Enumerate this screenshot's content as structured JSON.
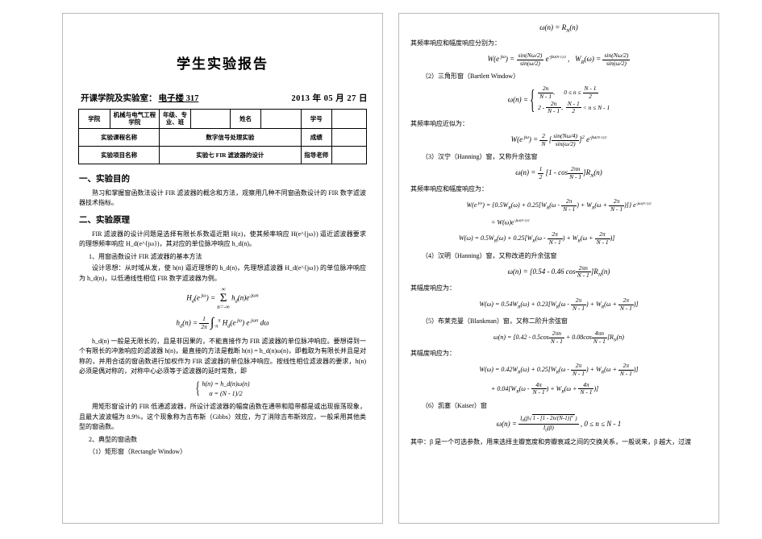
{
  "document": {
    "title": "学生实验报告",
    "meta": {
      "label": "开课学院及实验室：",
      "value": "电子楼 317",
      "date": "2013 年 05 月 27 日"
    },
    "info_table": {
      "row1": [
        "学院",
        "机械与电气工程学院",
        "年级、专业、班",
        "姓名",
        "学号"
      ],
      "row2_label": "实验课程名称",
      "row2_value": "数字信号处理实验",
      "row2_grade_label": "成绩",
      "row3_label": "实验项目名称",
      "row3_value": "实验七   FIR 滤波器的设计",
      "row3_teacher_label": "指导老师"
    },
    "sections": [
      {
        "heading": "一、实验目的",
        "paragraphs": [
          "熟习和掌握窗函数法设计 FIR 滤波器的概念和方法，观察用几种不同窗函数设计的 FIR 数字滤波器技术指标。"
        ]
      },
      {
        "heading": "二、实验原理",
        "paragraphs": [
          "FIR 滤波器的设计问题是选择有限长系数逼近期 H(z)，使其频率响应 H(e^{jω}) 逼近滤波器要求的理想频率响应 H_d(e^{jω})，其对应的单位脉冲响应 h_d(n)。"
        ],
        "sub1": "1、用窗函数设计 FIR 滤波器的基本方法",
        "sub1_paras": [
          "设计思想：从时域从发，使 h(n) 逼近理想的 h_d(n)，先理想滤波器 H_d(e^{jω}) 的单位脉冲响应为 h_d(n)，以低通线性相位 FIR 数字滤波器为例。"
        ],
        "eq1": "H_d(e^{jω}) = Σ h_d(n)e^{-jωn}",
        "eq2": "h_d(n) = (1/2π) ∫ H_d(e^{jω}) e^{jωn} dω",
        "sub1_paras2": [
          "h_d(n) 一般是无限长的，且是非因果的，不能直接作为 FIR 滤波器的单位脉冲响应。要想得到一个有限长的冲激响应的滤波器 h(n)，最直接的方法是截断 h(n) = h_d(n)ω(n)，即截取为有限长并且是对称的，并用合适的窗函数进行加权作为 FIR 滤波器的单位脉冲响应。按线性相位滤波器的要求，h(n) 必须是偶对称的，对称中心必须等于滤波器的延时常数，即",
          "用矩形窗设计的 FIR 低通滤波器，所设计滤波器的幅度函数在通带和阻带都是或出现振荡现象，且最大波波幅为 8.9%，这个现象称为吉布斯（Gibbs）效应，为了消除吉布斯效应，一般采用其他类型的窗函数。"
        ],
        "sub2": "2、典型的窗函数",
        "sub2_item": "（1）矩形窗（Rectangle Window）"
      }
    ],
    "system_eq": {
      "line1": "h(n) = h_d(n)ω(n)",
      "line2": "α = (N - 1)/2"
    }
  },
  "right_page": {
    "eq_top": "ω(n) = R_N(n)",
    "line_amp1": "其频率响应和幅度响应分别为：",
    "eq_w1": "W(e^{jω}) = [sin(Nω/2) / sin(ω/2)] e^{-jω(N-1)/2} ,   W_R(ω) = sin(Nω/2)/sin(ω/2)",
    "sub2": "（2）三角形窗（Bartlett Window）",
    "eq_bartlett_line1": "2n/(N-1),            0 ≤ n ≤ (N-1)/2",
    "eq_bartlett_line2": "2 - 2n/(N-1),      (N-1)/2 < n ≤ N-1",
    "eq_bartlett_head": "ω(n) =",
    "line_amp2": "其频率响应近似为：",
    "eq_w2": "W(e^{jω}) = (2/N)[sin(Nω/4)/sin(ω/2)]² e^{-jω(N-1)/2}",
    "sub3": "（3）汉宁（Hanning）窗，又称升余弦窗",
    "eq_hanning": "ω(n) = (1/2)[1 - cos(2πn/(N-1))]R_N(n)",
    "line_amp3": "其频率响应和幅度响应为：",
    "eq_h1": "W(e^{jω}) = {0.5W_R(ω) + 0.25[W_R(ω - 2π/(N-1)) + W_R(ω + 2π/(N-1))]} e^{-jω(N-1)/2}",
    "eq_h2": "= W(ω)e^{-jω(N-1)/2}",
    "eq_h3": "W(ω) = 0.5W_R(ω) + 0.25[W_R(ω - 2π/(N-1)) + W_R(ω + 2π/(N-1))]",
    "sub4": "（4）汉明（Hanning）窗，又称改进的升余弦窗",
    "eq_hamming": "ω(n) = [0.54 - 0.46 cos(2πn/(N-1))]R_N(n)",
    "line_amp4": "其幅度响应为：",
    "eq_hamming_amp": "W(ω) = 0.54W_R(ω) + 0.23[W_R(ω - 2π/(N-1)) + W_R(ω + 2π/(N-1))]",
    "sub5": "（5）布莱克曼（Blankman）窗，又称二阶升余弦窗",
    "eq_blackman": "ω(n) = [0.42 - 0.5cos(2πn/(N-1)) + 0.08cos(4πn/(N-1))]R_N(n)",
    "line_amp5": "其幅度响应为：",
    "eq_bm1": "W(ω) = 0.42W_R(ω) + 0.25[W_R(ω - 2π/(N-1)) + W_R(ω + 2π/(N-1))]",
    "eq_bm2": "+ 0.04[W_R(ω - 4π/(N-1)) + W_R(ω + 4π/(N-1))]",
    "sub6": "（6）凯塞（Kaiser）窗",
    "eq_kaiser_num": "I₀(β√(1 - [1 - 2n/(N-1)]²))",
    "eq_kaiser_den": "I₀(β)",
    "eq_kaiser_head": "ω(n) =",
    "eq_kaiser_tail": ", 0 ≤ n ≤ N - 1",
    "footer": "其中：β 是一个可选参数，用来选择主瓣宽度和旁瓣衰减之间的交换关系，一般说来，β 越大，过渡"
  }
}
